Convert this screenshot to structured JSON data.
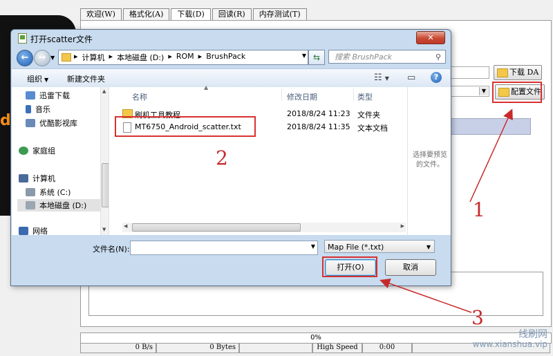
{
  "background_app": {
    "phone_glyph": "d",
    "tabs": [
      {
        "label": "欢迎(W)"
      },
      {
        "label": "格式化(A)"
      },
      {
        "label": "下载(D)"
      },
      {
        "label": "回读(R)"
      },
      {
        "label": "内存测试(T)"
      }
    ],
    "active_tab": "下载(D)",
    "download_da_label": "下载 DA",
    "config_file_label": "配置文件",
    "progress_text": "0%",
    "status": {
      "speed": "0 B/s",
      "bytes": "0 Bytes",
      "mode": "High Speed",
      "time": "0:00"
    },
    "watermark": {
      "cn": "线刷网",
      "url": "www.xianshua.vip"
    }
  },
  "annotations": {
    "step1": "1",
    "step2": "2",
    "step3": "3",
    "color": "#c62a2a"
  },
  "dialog": {
    "title": "打开scatter文件",
    "close_glyph": "✕",
    "breadcrumb": [
      "▸",
      "计算机",
      "▸",
      "本地磁盘 (D:)",
      "▸",
      "ROM",
      "▸",
      "BrushPack"
    ],
    "search_placeholder": "搜索 BrushPack",
    "organize_label": "组织",
    "new_folder_label": "新建文件夹",
    "nav_items": [
      {
        "label": "迅雷下载",
        "icon": "download-folder-icon"
      },
      {
        "label": "音乐",
        "icon": "music-icon"
      },
      {
        "label": "优酷影视库",
        "icon": "video-library-icon"
      },
      {
        "label": "家庭组",
        "icon": "homegroup-icon"
      },
      {
        "label": "计算机",
        "icon": "computer-icon"
      },
      {
        "label": "系统 (C:)",
        "icon": "drive-c-icon"
      },
      {
        "label": "本地磁盘 (D:)",
        "icon": "drive-d-icon"
      },
      {
        "label": "网络",
        "icon": "network-icon"
      }
    ],
    "selected_nav": "本地磁盘 (D:)",
    "columns": [
      "名称",
      "修改日期",
      "类型"
    ],
    "files": [
      {
        "name": "刷机工具教程",
        "date": "2018/8/24 11:23",
        "type": "文件夹",
        "icon": "folder-icon"
      },
      {
        "name": "MT6750_Android_scatter.txt",
        "date": "2018/8/24 11:35",
        "type": "文本文档",
        "icon": "text-file-icon"
      }
    ],
    "preview_text": "选择要预览的文件。",
    "filename_label": "文件名(N):",
    "filename_value": "",
    "filter_value": "Map File (*.txt)",
    "open_label": "打开(O)",
    "cancel_label": "取消"
  }
}
